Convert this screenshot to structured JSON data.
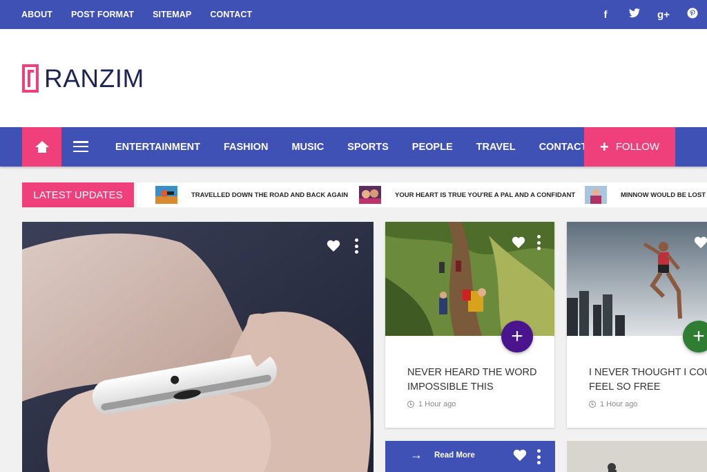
{
  "topnav": {
    "links": [
      "ABOUT",
      "POST FORMAT",
      "SITEMAP",
      "CONTACT"
    ],
    "social_icons": [
      "facebook-icon",
      "twitter-icon",
      "google-plus-icon",
      "pinterest-icon"
    ],
    "social_glyphs": [
      "f",
      "t",
      "g+",
      "p"
    ]
  },
  "header": {
    "logo_text": "RANZIM"
  },
  "mainnav": {
    "items": [
      "ENTERTAINMENT",
      "FASHION",
      "MUSIC",
      "SPORTS",
      "PEOPLE",
      "TRAVEL",
      "CONTACT"
    ],
    "follow_label": "FOLLOW"
  },
  "ticker": {
    "label": "LATEST UPDATES",
    "items": [
      {
        "text": "TRAVELLED DOWN THE ROAD AND BACK AGAIN"
      },
      {
        "text": "YOUR HEART IS TRUE YOU'RE A PAL AND A CONFIDANT"
      },
      {
        "text": "MINNOW WOULD BE LOST"
      }
    ]
  },
  "cards": [
    {
      "title": "NEVER HEARD THE WORD IMPOSSIBLE THIS",
      "time": "1 Hour ago",
      "fab_color": "#4a148c"
    },
    {
      "title": "I NEVER THOUGHT I COULD FEEL SO FREE",
      "time": "1 Hour ago",
      "fab_color": "#2e7d32"
    }
  ],
  "readmore": {
    "label": "Read More"
  },
  "colors": {
    "primary": "#3f51b5",
    "accent": "#f0407b",
    "dark_text": "#1d2452"
  }
}
